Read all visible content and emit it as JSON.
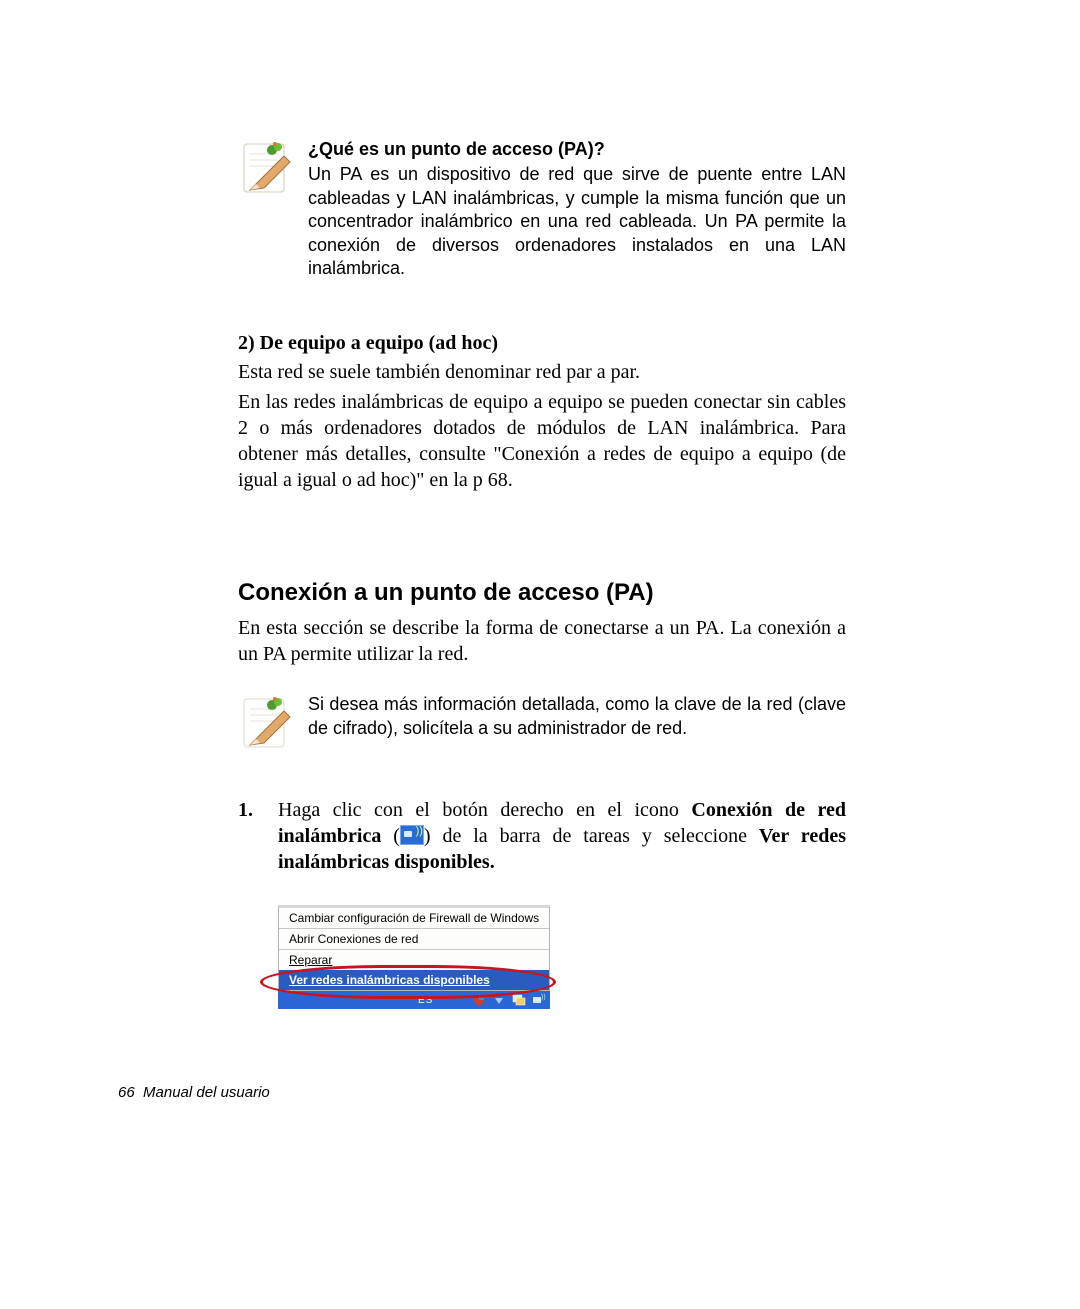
{
  "note1": {
    "title": "¿Qué es un punto de acceso (PA)?",
    "body": "Un PA es un dispositivo de red que sirve de puente entre LAN cableadas y LAN inalámbricas, y cumple la misma función que un concentrador inalámbrico en una red cableada. Un PA permite la conexión de diversos ordenadores instalados en una LAN inalámbrica."
  },
  "adhoc": {
    "heading": "2) De equipo a equipo (ad hoc)",
    "p1": "Esta red se suele también denominar red par a par.",
    "p2": "En las redes inalámbricas de equipo a equipo se pueden conectar sin cables 2 o más ordenadores dotados de módulos de LAN inalámbrica. Para obtener más detalles, consulte \"Conexión a redes de equipo a equipo (de igual a igual o ad hoc)\" en la p 68."
  },
  "section": {
    "heading": "Conexión a un punto de acceso (PA)",
    "intro": "En esta sección se describe la forma de conectarse a un PA. La conexión a un PA permite utilizar la red."
  },
  "note2": {
    "body": "Si desea más información detallada, como la clave de la red (clave de cifrado), solicítela a su administrador de red."
  },
  "step1": {
    "num": "1.",
    "a": "Haga clic con el botón derecho en el icono ",
    "b": "Conexión de red inalámbrica",
    "c": " (",
    "d": ") de la barra de tareas y seleccione ",
    "e": "Ver redes inalámbricas disponibles."
  },
  "menu": {
    "item1": "Cambiar configuración de Firewall de Windows",
    "item2": "Abrir Conexiones de red",
    "item3": "Reparar",
    "item4": "Ver redes inalámbricas disponibles",
    "taskbar_label": "ES"
  },
  "footer": {
    "page": "66",
    "label": "Manual del usuario"
  }
}
